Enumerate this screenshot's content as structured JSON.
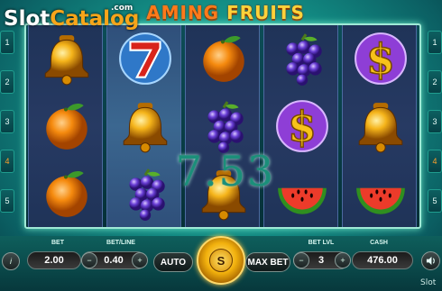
{
  "brand": {
    "watermark": "SlotCatalog",
    "watermark_part1": "Slot",
    "watermark_part2": "Catalog",
    "watermark_com": ".com",
    "watermark_bottom": "Slot"
  },
  "game": {
    "title_part1": "AMING",
    "title_part2": " FRUITS"
  },
  "paylines": {
    "left": [
      "1",
      "2",
      "3",
      "4",
      "5"
    ],
    "right": [
      "1",
      "2",
      "3",
      "4",
      "5"
    ],
    "highlighted": "4"
  },
  "reels": [
    [
      "bell",
      "orange",
      "orange"
    ],
    [
      "seven",
      "bell",
      "grapes"
    ],
    [
      "orange",
      "grapes",
      "bell"
    ],
    [
      "grapes",
      "dollar",
      "watermelon"
    ],
    [
      "dollar",
      "bell",
      "watermelon"
    ]
  ],
  "win": {
    "amount": "7.53"
  },
  "controls": {
    "bet_label": "BET",
    "bet_value": "2.00",
    "betline_label": "BET/LINE",
    "betline_value": "0.40",
    "auto_label": "AUTO",
    "spin_label": "S",
    "maxbet_label": "MAX BET",
    "betlvl_label": "BET LVL",
    "betlvl_value": "3",
    "cash_label": "CASH",
    "cash_value": "476.00",
    "minus": "−",
    "plus": "+"
  },
  "icons": {
    "info": "info-icon",
    "sound": "speaker-icon"
  },
  "colors": {
    "accent": "#f2b10d",
    "frame_glow": "#71e7c6",
    "win_text": "#1b8f7a"
  }
}
